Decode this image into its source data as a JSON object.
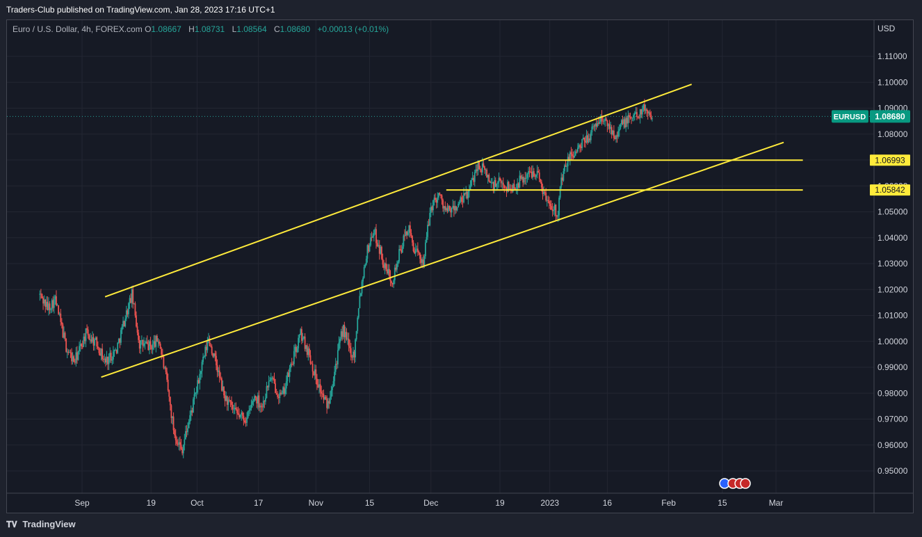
{
  "header": {
    "publisher_line": "Traders-Club published on TradingView.com, Jan 28, 2023 17:16 UTC+1"
  },
  "legend": {
    "symbol": "Euro / U.S. Dollar, 4h, FOREX.com",
    "o_label": "O",
    "o_value": "1.08667",
    "h_label": "H",
    "h_value": "1.08731",
    "l_label": "L",
    "l_value": "1.08564",
    "c_label": "C",
    "c_value": "1.08680",
    "change": "+0.00013 (+0.01%)"
  },
  "footer": {
    "brand": "TradingView"
  },
  "colors": {
    "background": "#161a25",
    "up": "#26a69a",
    "down": "#ef5350",
    "drawing": "#ffeb3b",
    "price_label": "#089981"
  },
  "chart_data": {
    "type": "candlestick",
    "symbol": "EURUSD",
    "currency": "USD",
    "interval": "4h",
    "last_price": "1.08680",
    "y_ticks": [
      "1.11000",
      "1.10000",
      "1.09000",
      "1.08000",
      "1.07000",
      "1.06000",
      "1.05000",
      "1.04000",
      "1.03000",
      "1.02000",
      "1.01000",
      "1.00000",
      "0.99000",
      "0.98000",
      "0.97000",
      "0.96000",
      "0.95000"
    ],
    "ylim": [
      0.942,
      1.1206
    ],
    "x_ticks": [
      {
        "day": 0,
        "label": "Sep"
      },
      {
        "day": 18,
        "label": "19"
      },
      {
        "day": 30,
        "label": "Oct"
      },
      {
        "day": 46,
        "label": "17"
      },
      {
        "day": 61,
        "label": "Nov"
      },
      {
        "day": 75,
        "label": "15"
      },
      {
        "day": 91,
        "label": "Dec"
      },
      {
        "day": 109,
        "label": "19"
      },
      {
        "day": 122,
        "label": "2023"
      },
      {
        "day": 137,
        "label": "16"
      },
      {
        "day": 153,
        "label": "Feb"
      },
      {
        "day": 167,
        "label": "15"
      },
      {
        "day": 181,
        "label": "Mar"
      }
    ],
    "price_path": [
      [
        -11,
        1.018
      ],
      [
        -9,
        1.013
      ],
      [
        -7,
        1.016
      ],
      [
        -4,
        0.997
      ],
      [
        -2,
        0.992
      ],
      [
        1,
        1.003
      ],
      [
        4,
        0.999
      ],
      [
        6,
        0.992
      ],
      [
        9,
        0.997
      ],
      [
        11,
        1.008
      ],
      [
        13,
        1.018
      ],
      [
        15,
        0.999
      ],
      [
        18,
        0.998
      ],
      [
        20,
        1.001
      ],
      [
        22,
        0.985
      ],
      [
        24,
        0.965
      ],
      [
        26,
        0.958
      ],
      [
        28,
        0.97
      ],
      [
        30,
        0.982
      ],
      [
        31,
        0.989
      ],
      [
        33,
        1.001
      ],
      [
        35,
        0.991
      ],
      [
        37,
        0.979
      ],
      [
        40,
        0.972
      ],
      [
        43,
        0.97
      ],
      [
        45,
        0.979
      ],
      [
        47,
        0.975
      ],
      [
        49,
        0.986
      ],
      [
        52,
        0.978
      ],
      [
        54,
        0.988
      ],
      [
        57,
        1.003
      ],
      [
        59,
        0.996
      ],
      [
        61,
        0.986
      ],
      [
        63,
        0.978
      ],
      [
        64,
        0.975
      ],
      [
        66,
        0.99
      ],
      [
        68,
        1.005
      ],
      [
        70,
        0.996
      ],
      [
        71,
        0.995
      ],
      [
        72,
        1.013
      ],
      [
        74,
        1.033
      ],
      [
        76,
        1.043
      ],
      [
        78,
        1.034
      ],
      [
        79,
        1.028
      ],
      [
        81,
        1.024
      ],
      [
        83,
        1.035
      ],
      [
        85,
        1.044
      ],
      [
        87,
        1.034
      ],
      [
        89,
        1.031
      ],
      [
        91,
        1.052
      ],
      [
        93,
        1.057
      ],
      [
        95,
        1.05
      ],
      [
        97,
        1.051
      ],
      [
        99,
        1.054
      ],
      [
        101,
        1.058
      ],
      [
        103,
        1.068
      ],
      [
        105,
        1.066
      ],
      [
        107,
        1.06
      ],
      [
        109,
        1.061
      ],
      [
        112,
        1.059
      ],
      [
        115,
        1.063
      ],
      [
        118,
        1.066
      ],
      [
        119,
        1.064
      ],
      [
        121,
        1.055
      ],
      [
        123,
        1.052
      ],
      [
        124,
        1.049
      ],
      [
        125,
        1.062
      ],
      [
        127,
        1.071
      ],
      [
        130,
        1.075
      ],
      [
        133,
        1.081
      ],
      [
        135,
        1.086
      ],
      [
        137,
        1.084
      ],
      [
        139,
        1.08
      ],
      [
        141,
        1.084
      ],
      [
        143,
        1.086
      ],
      [
        145,
        1.088
      ],
      [
        147,
        1.09
      ],
      [
        148,
        1.088
      ],
      [
        149,
        1.0868
      ]
    ],
    "trend_lines": [
      {
        "name": "channel-upper",
        "from": [
          6,
          1.0172
        ],
        "to": [
          159,
          1.0992
        ]
      },
      {
        "name": "channel-lower",
        "from": [
          5,
          0.9862
        ],
        "to": [
          183,
          1.0768
        ]
      },
      {
        "name": "level-1",
        "from": [
          106,
          1.06993
        ],
        "to": [
          188,
          1.06993
        ],
        "label": "1.06993"
      },
      {
        "name": "level-2",
        "from": [
          95,
          1.05842
        ],
        "to": [
          188,
          1.05842
        ],
        "label": "1.05842"
      }
    ],
    "grid": true,
    "y_axis_position": "right"
  }
}
